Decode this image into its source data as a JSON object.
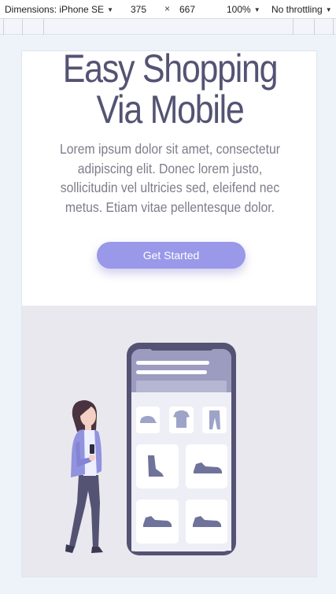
{
  "devtools": {
    "device_label": "Dimensions: iPhone SE",
    "width": "375",
    "times": "×",
    "height": "667",
    "zoom": "100%",
    "throttling": "No throttling"
  },
  "page": {
    "title_line1": "Easy Shopping",
    "title_line2": "Via Mobile",
    "description": "Lorem ipsum dolor sit amet, consectetur adipiscing elit. Donec lorem justo, sollicitudin vel ultricies sed, eleifend nec metus. Etiam vitae pellentesque dolor.",
    "cta_label": "Get Started"
  },
  "colors": {
    "title": "#545373",
    "accent": "#9a98e8",
    "phone_body": "#545373",
    "illustration_bg": "#e9e8ee"
  },
  "illustration": {
    "phone_items": [
      "cap-icon",
      "tshirt-icon",
      "pants-icon",
      "boot-icon",
      "sneaker-icon",
      "sneaker-icon",
      "sneaker-icon"
    ]
  }
}
